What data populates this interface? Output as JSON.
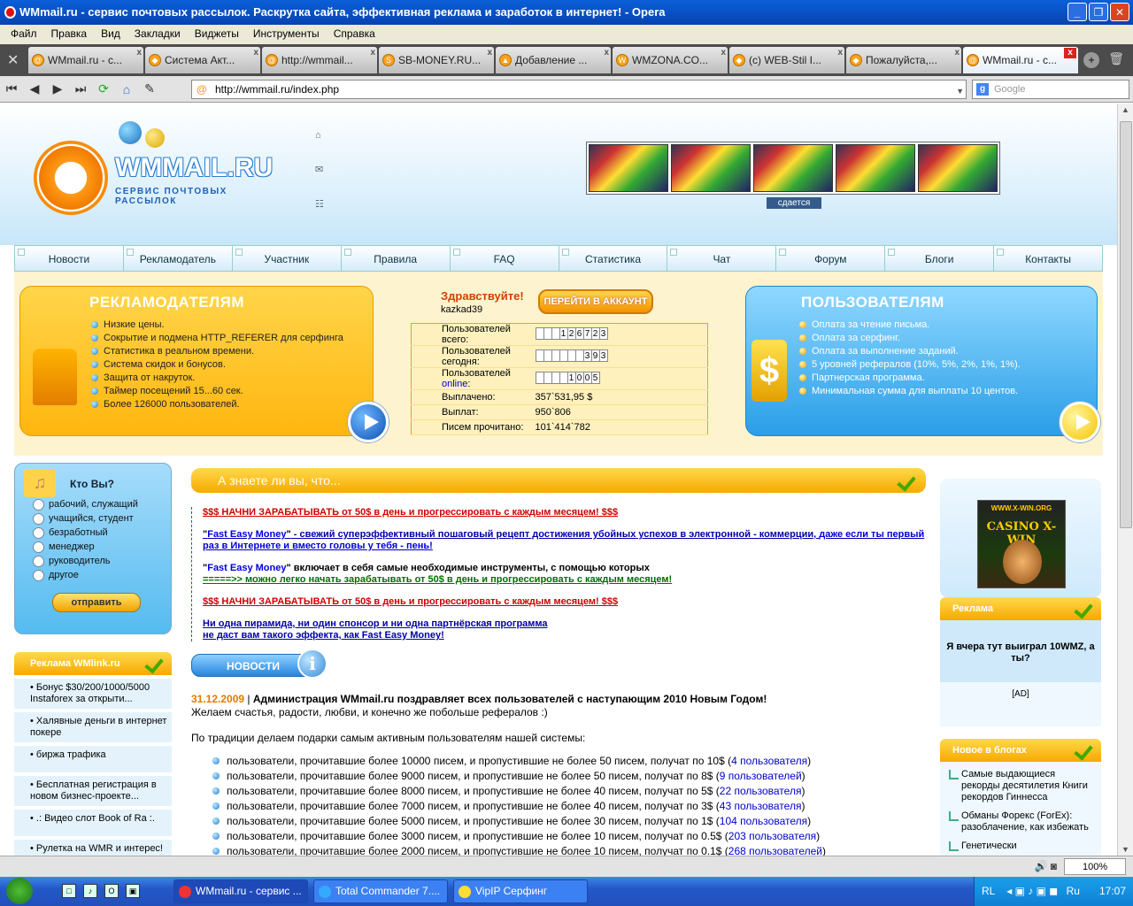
{
  "window": {
    "title": "WMmail.ru - сервис почтовых рассылок. Раскрутка сайта, эффективная реклама и заработок в интернет! - Opera",
    "buttons": [
      "_",
      "❐",
      "✕"
    ]
  },
  "menu": [
    "Файл",
    "Правка",
    "Вид",
    "Закладки",
    "Виджеты",
    "Инструменты",
    "Справка"
  ],
  "tabs": [
    {
      "label": "WMmail.ru - с...",
      "icon": "@",
      "active": false
    },
    {
      "label": "Система Акт...",
      "icon": "◆",
      "active": false
    },
    {
      "label": "http://wmmail...",
      "icon": "@",
      "active": false
    },
    {
      "label": "SB-MONEY.RU...",
      "icon": "S",
      "active": false
    },
    {
      "label": "Добавление ...",
      "icon": "▲",
      "active": false
    },
    {
      "label": "WMZONA.CO...",
      "icon": "W",
      "active": false
    },
    {
      "label": "(c) WEB-Stil I...",
      "icon": "◆",
      "active": false
    },
    {
      "label": "Пожалуйста,...",
      "icon": "◆",
      "active": false
    },
    {
      "label": "WMmail.ru - с...",
      "icon": "@",
      "active": true
    }
  ],
  "address": {
    "url": "http://wmmail.ru/index.php",
    "search_placeholder": "Google"
  },
  "header": {
    "logo_word": "WMMAIL.RU",
    "logo_sub": "СЕРВИС ПОЧТОВЫХ РАССЫЛОК",
    "banner_tag": "сдается"
  },
  "nav": [
    "Новости",
    "Рекламодатель",
    "Участник",
    "Правила",
    "FAQ",
    "Статистика",
    "Чат",
    "Форум",
    "Блоги",
    "Контакты"
  ],
  "advertisers": {
    "title": "РЕКЛАМОДАТЕЛЯМ",
    "items": [
      "Низкие цены.",
      "Сокрытие и подмена HTTP_REFERER для серфинга",
      "Статистика в реальном времени.",
      "Система скидок и бонусов.",
      "Защита от накруток.",
      "Таймер посещений 15...60 сек.",
      "Более 126000 пользователей."
    ]
  },
  "account": {
    "greeting": "Здравствуйте!",
    "username": "kazkad39",
    "button": "ПЕРЕЙТИ В АККАУНТ",
    "stats": [
      {
        "label": "Пользователей всего:",
        "value": "126723",
        "type": "digits",
        "cells": 9
      },
      {
        "label": "Пользователей сегодня:",
        "value": "393",
        "type": "digits",
        "cells": 9
      },
      {
        "label_prefix": "Пользователей ",
        "label_link": "online",
        "label_suffix": ":",
        "value": "1005",
        "type": "digits",
        "cells": 8
      },
      {
        "label": "Выплачено:",
        "value": "357`531,95 $",
        "type": "text"
      },
      {
        "label": "Выплат:",
        "value": "950`806",
        "type": "text"
      },
      {
        "label": "Писем прочитано:",
        "value": "101`414`782",
        "type": "text"
      }
    ]
  },
  "users": {
    "title": "ПОЛЬЗОВАТЕЛЯМ",
    "items": [
      "Оплата за чтение письма.",
      "Оплата за серфинг.",
      "Оплата за выполнение заданий.",
      "5 уровней рефералов (10%, 5%, 2%, 1%, 1%).",
      "Партнерская программа.",
      "Минимальная сумма для выплаты 10 центов."
    ]
  },
  "poll": {
    "title": "Кто Вы?",
    "options": [
      "рабочий, служащий",
      "учащийся, студент",
      "безработный",
      "менеджер",
      "руководитель",
      "другое"
    ],
    "submit": "отправить"
  },
  "wmlink": {
    "title": "Реклама WMlink.ru",
    "items": [
      "Бонус $30/200/1000/5000 Instaforex за открыти...",
      "Халявные деньги в интернет покере",
      "биржа трафика",
      "Бесплатная регистрация в новом бизнес-проекте...",
      ".: Видео слот Book of Ra :.",
      "Рулетка на WMR и интерес!"
    ]
  },
  "didyouknow": {
    "title": "А знаете ли вы, что...",
    "line1": "$$$ НАЧНИ ЗАРАБАТЫВАТЬ от 50$ в день и прогрессировать с каждым месяцем! $$$",
    "p2_q1": "\"",
    "p2_link": "Fast Easy Money",
    "p2_q2": "\"",
    "p2_rest": " - свежий суперэффективный пошаговый рецепт достижения убойных успехов в электронной - коммерции, ",
    "p2_rest2": "даже если ты первый раз в Интернете и вместо головы у тебя - пень!",
    "p3_q1": "\"",
    "p3_link": "Fast Easy Money",
    "p3_q2": "\"",
    "p3_rest": " включает в себя самые необходимые инструменты, с помощью которых",
    "p3_green": "=====>> можно легко начать зарабатывать от 50$ в день и прогрессировать с каждым месяцем!",
    "line4": "$$$ НАЧНИ ЗАРАБАТЫВАТЬ от 50$ в день и прогрессировать с каждым месяцем! $$$",
    "p5_l1": "Ни одна пирамида, ни один спонсор и ни одна партнёрская программа",
    "p5_l2": "не даст вам такого эффекта, как Fast Easy Money!"
  },
  "news": {
    "button": "НОВОСТИ",
    "date": "31.12.2009",
    "separator": " | ",
    "title": "Администрация WMmail.ru поздравляет всех пользователей с наступающим 2010 Новым Годом!",
    "wish": "Желаем счастья, радости, любви, и конечно же побольше рефералов :)",
    "intro": "По традиции делаем подарки самым активным пользователям нашей системы:",
    "items": [
      {
        "text": "пользователи, прочитавшие более 10000 писем, и пропустившие не более 50 писем, получат по 10$ (",
        "link": "4 пользователя",
        "end": ")"
      },
      {
        "text": "пользователи, прочитавшие более 9000 писем, и пропустившие не более 50 писем, получат по 8$ (",
        "link": "9 пользователей",
        "end": ")"
      },
      {
        "text": "пользователи, прочитавшие более 8000 писем, и пропустившие не более 40 писем, получат по 5$ (",
        "link": "22 пользователя",
        "end": ")"
      },
      {
        "text": "пользователи, прочитавшие более 7000 писем, и пропустившие не более 40 писем, получат по 3$ (",
        "link": "43 пользователя",
        "end": ")"
      },
      {
        "text": "пользователи, прочитавшие более 5000 писем, и пропустившие не более 30 писем, получат по 1$ (",
        "link": "104 пользователя",
        "end": ")"
      },
      {
        "text": "пользователи, прочитавшие более 3000 писем, и пропустившие не более 10 писем, получат по 0.5$ (",
        "link": "203 пользователя",
        "end": ")"
      },
      {
        "text": "пользователи, прочитавшие более 2000 писем, и пропустившие не более 10 писем, получат по 0.1$ (",
        "link": "268 пользователей",
        "end": ")"
      }
    ]
  },
  "right": {
    "banner_url": "WWW.X-WIN.ORG",
    "banner_name": "CASINO X-WIN",
    "reklama_title": "Реклама",
    "reklama_link": "Я вчера тут выиграл 10WMZ, а ты?",
    "ad_label": "[AD]",
    "blogs_title": "Новое в блогах",
    "blogs": [
      "Самые выдающиеся рекорды десятилетия Книги рекордов Гиннесса",
      "Обманы Форекс (ForEx): разоблачение, как избежать",
      "Генетически"
    ]
  },
  "status": {
    "zoom": "100%"
  },
  "taskbar": {
    "buttons": [
      {
        "label": "WMmail.ru - сервис ...",
        "active": true
      },
      {
        "label": "Total Commander 7....",
        "active": false
      },
      {
        "label": "VipIP Серфинг",
        "active": false
      }
    ],
    "lang": "RL",
    "lang2": "Ru",
    "time": "17:07"
  },
  "colors": {
    "titlebar": "#0a5fd8",
    "accent_orange": "#f7a900",
    "accent_blue": "#2a9ee8",
    "alert_red": "#d10000"
  }
}
